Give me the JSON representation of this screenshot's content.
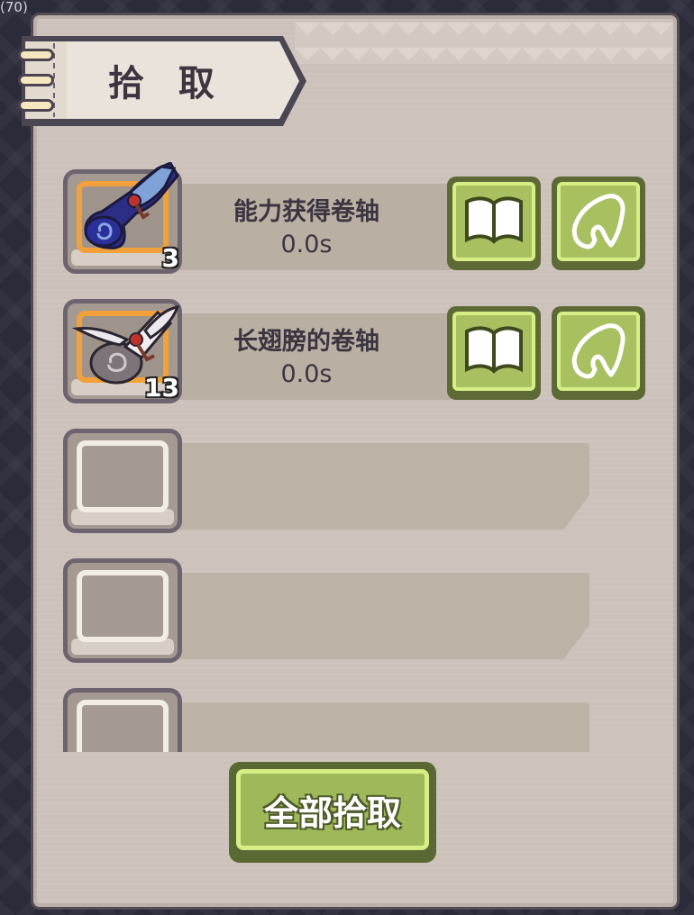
{
  "background": {
    "badge_text": "(70)"
  },
  "panel": {
    "title": "拾 取",
    "colors": {
      "panel": "#ccc2bb",
      "accent_green": "#a8c060",
      "slot_selected": "#f2a13a"
    }
  },
  "items": [
    {
      "name": "能力获得卷轴",
      "time": "0.0s",
      "count": "3",
      "icon": "blue-scroll-icon",
      "actions": {
        "detail_icon": "book-icon",
        "pick_icon": "grab-hand-icon"
      }
    },
    {
      "name": "长翅膀的卷轴",
      "time": "0.0s",
      "count": "13",
      "icon": "winged-scroll-icon",
      "actions": {
        "detail_icon": "book-icon",
        "pick_icon": "grab-hand-icon"
      }
    }
  ],
  "empty_slots": 3,
  "footer": {
    "pick_all_label": "全部拾取"
  }
}
